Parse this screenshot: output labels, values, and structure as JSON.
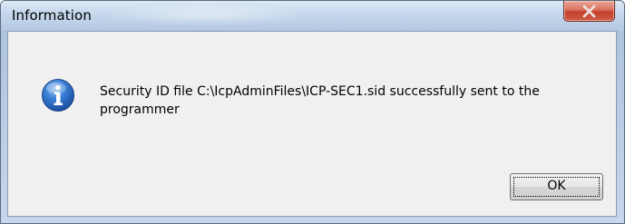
{
  "window": {
    "title": "Information",
    "close_icon": "close-icon"
  },
  "dialog": {
    "icon": "info-icon",
    "message": "Security ID file C:\\IcpAdminFiles\\ICP-SEC1.sid successfully sent to the programmer",
    "ok_label": "OK"
  },
  "colors": {
    "titlebar": "#c5d7ec",
    "client_bg": "#f0f0f0",
    "close_button": "#c2412c",
    "info_icon": "#2f6fc4"
  }
}
